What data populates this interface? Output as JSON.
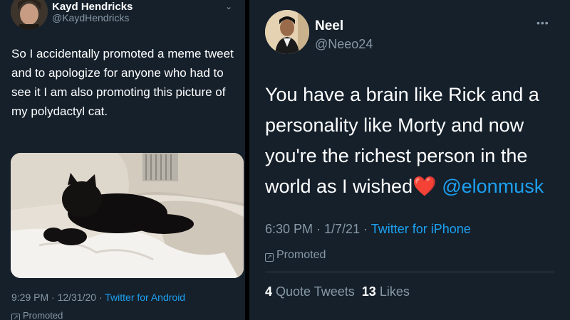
{
  "left_tweet": {
    "name": "Kayd Hendricks",
    "handle": "@KaydHendricks",
    "text": "So I accidentally promoted a meme tweet and to apologize for anyone who had to see it I am also promoting this picture of my polydactyl cat.",
    "time": "9:29 PM · 12/31/20 · ",
    "source": "Twitter for Android",
    "promoted": "Promoted",
    "icons": [
      "chevron-down-icon",
      "promoted-icon"
    ]
  },
  "right_tweet": {
    "name": "Neel",
    "handle": "@Neeo24",
    "text": "You have a brain like Rick and a personality like Morty and now you're the richest person in the world as I wished",
    "emoji": "❤️",
    "mention": "@elonmusk",
    "time": "6:30 PM · 1/7/21 · ",
    "source": "Twitter for iPhone",
    "promoted": "Promoted",
    "quote_count": "4",
    "quote_label": "Quote Tweets",
    "likes_count": "13",
    "likes_label": "Likes",
    "icons": [
      "more-icon",
      "promoted-icon"
    ]
  },
  "colors": {
    "background": "#15202b",
    "text": "#ffffff",
    "muted": "#8899a6",
    "link": "#1da1f2",
    "heart": "#e0245e"
  }
}
